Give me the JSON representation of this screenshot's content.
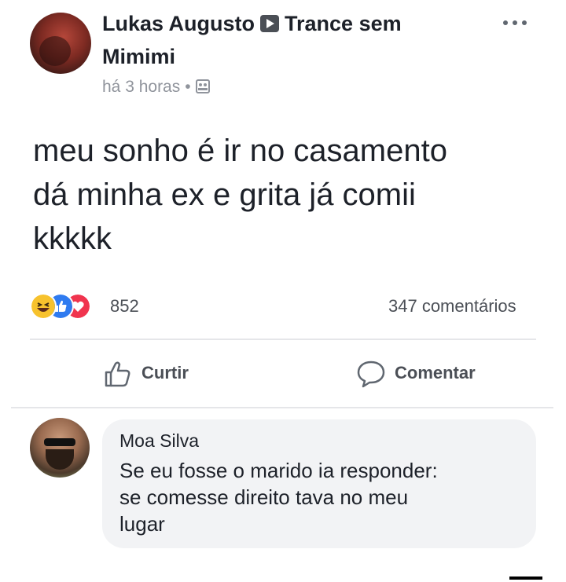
{
  "post": {
    "author": "Lukas Augusto",
    "group_line1": "Trance sem",
    "group_line2": "Mimimi",
    "time": "há 3 horas",
    "separator": "•",
    "text_line1": "meu sonho é ir no casamento",
    "text_line2": "dá minha ex e grita já comii",
    "text_line3": "kkkkk",
    "reaction_count": "852",
    "comments_count": "347 comentários",
    "reactions": [
      "haha-icon",
      "like-icon",
      "love-icon"
    ]
  },
  "actions": {
    "like_label": "Curtir",
    "comment_label": "Comentar"
  },
  "comment": {
    "author": "Moa Silva",
    "text_line1": "Se eu fosse o marido ia responder:",
    "text_line2": "se comesse direito tava no meu",
    "text_line3": "lugar"
  },
  "colors": {
    "text": "#1d2129",
    "secondary": "#90949c",
    "like_blue": "#2f7bf0",
    "love_red": "#f0344e",
    "haha_yellow": "#f7c22d"
  }
}
